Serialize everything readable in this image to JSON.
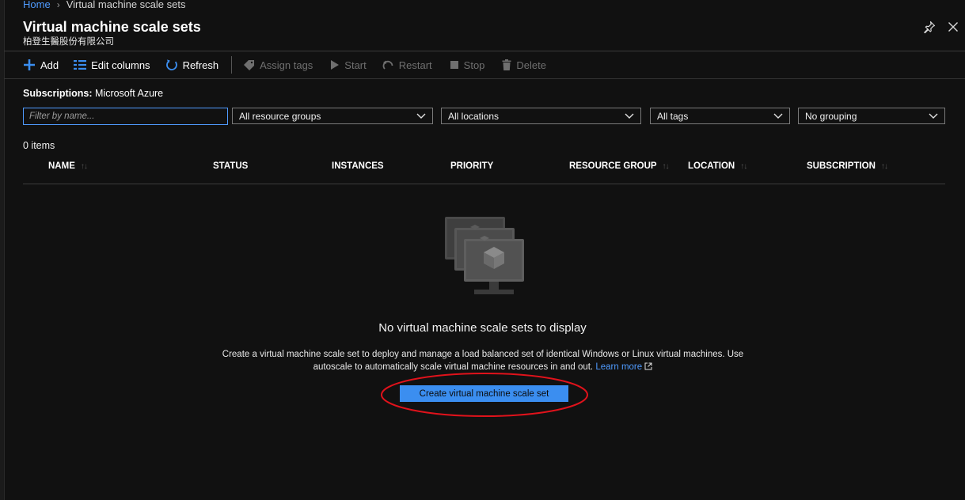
{
  "breadcrumb": {
    "home": "Home",
    "current": "Virtual machine scale sets"
  },
  "header": {
    "title": "Virtual machine scale sets",
    "subtitle": "柏登生醫股份有限公司"
  },
  "icons": {
    "pin": "pin-icon",
    "close": "close-icon"
  },
  "toolbar": {
    "add": "Add",
    "edit_columns": "Edit columns",
    "refresh": "Refresh",
    "assign_tags": "Assign tags",
    "start": "Start",
    "restart": "Restart",
    "stop": "Stop",
    "delete": "Delete"
  },
  "subscriptions": {
    "label": "Subscriptions:",
    "value": "Microsoft Azure"
  },
  "filters": {
    "name_placeholder": "Filter by name...",
    "resource_groups": "All resource groups",
    "locations": "All locations",
    "tags": "All tags",
    "grouping": "No grouping"
  },
  "table": {
    "count": "0 items",
    "columns": [
      "NAME",
      "STATUS",
      "INSTANCES",
      "PRIORITY",
      "RESOURCE GROUP",
      "LOCATION",
      "SUBSCRIPTION"
    ]
  },
  "empty_state": {
    "title": "No virtual machine scale sets to display",
    "description": "Create a virtual machine scale set to deploy and manage a load balanced set of identical Windows or Linux virtual machines. Use autoscale to automatically scale virtual machine resources in and out.",
    "learn_more": "Learn more",
    "button": "Create virtual machine scale set"
  },
  "colors": {
    "accent": "#3b8ef0",
    "link": "#4f9bff",
    "background": "#111111",
    "annotation": "#e0121b"
  }
}
